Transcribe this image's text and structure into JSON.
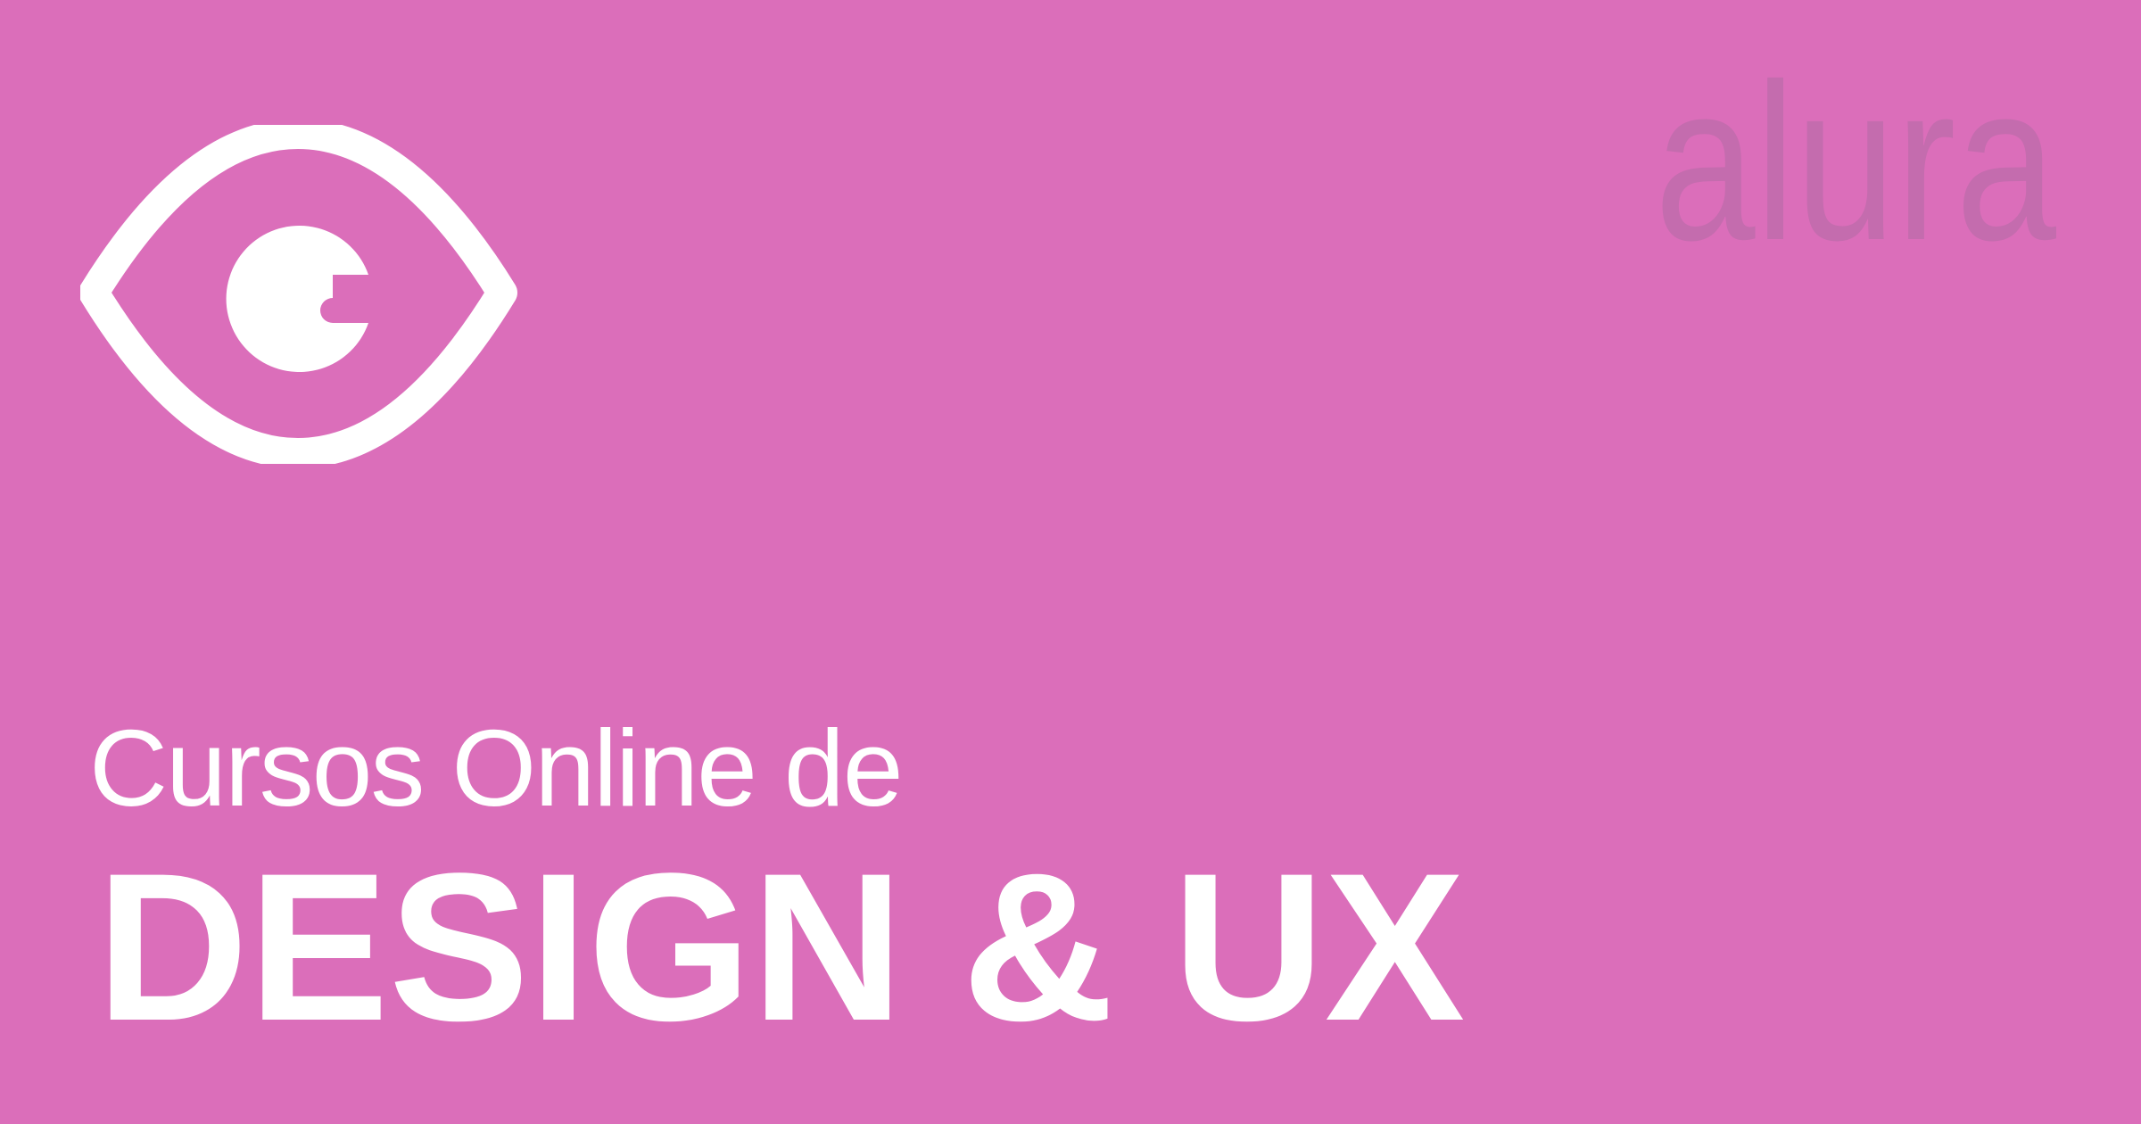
{
  "banner": {
    "subtitle": "Cursos Online de",
    "title": "DESIGN & UX",
    "logo_text": "alura",
    "icon": "eye-icon"
  },
  "colors": {
    "background": "#db6eba",
    "logo": "#c46cae",
    "text": "#ffffff"
  }
}
